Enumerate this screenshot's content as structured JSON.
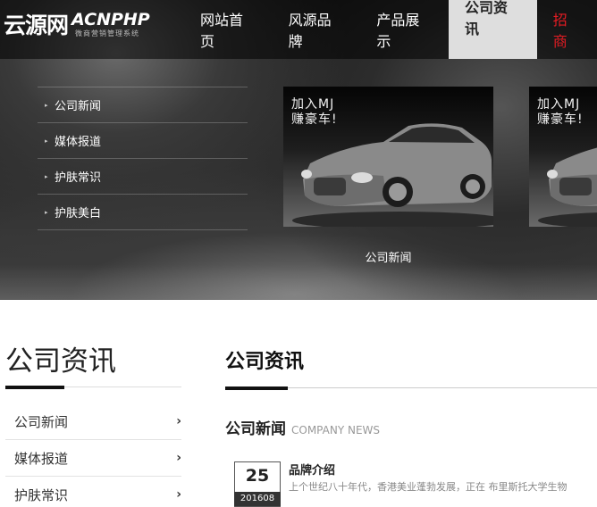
{
  "logo": {
    "cn": "云源网",
    "en": "ACNPHP",
    "sub": "微商营销管理系统"
  },
  "nav": [
    {
      "label": "网站首页"
    },
    {
      "label": "风源品牌"
    },
    {
      "label": "产品展示"
    },
    {
      "label": "公司资讯",
      "active": true
    },
    {
      "label": "招商"
    }
  ],
  "hero_menu": [
    {
      "label": "公司新闻"
    },
    {
      "label": "媒体报道"
    },
    {
      "label": "护肤常识"
    },
    {
      "label": "护肤美白"
    }
  ],
  "slides": [
    {
      "line1": "加入MJ",
      "line2": "赚豪车!"
    },
    {
      "line1": "加入MJ",
      "line2": "赚豪车!"
    }
  ],
  "slide_caption": "公司新闻",
  "sidebar": {
    "title": "公司资讯",
    "items": [
      {
        "label": "公司新闻"
      },
      {
        "label": "媒体报道"
      },
      {
        "label": "护肤常识"
      }
    ]
  },
  "main": {
    "title": "公司资讯",
    "section_cn": "公司新闻",
    "section_en": "COMPANY NEWS",
    "news": [
      {
        "day": "25",
        "ym": "201608",
        "title": "品牌介绍",
        "summary": "上个世纪八十年代，香港美业蓬勃发展，正在 布里斯托大学生物"
      }
    ]
  },
  "colors": {
    "nav_active_bg": "#dedede",
    "nav_highlight": "#e51c23",
    "dark": "#111111"
  }
}
